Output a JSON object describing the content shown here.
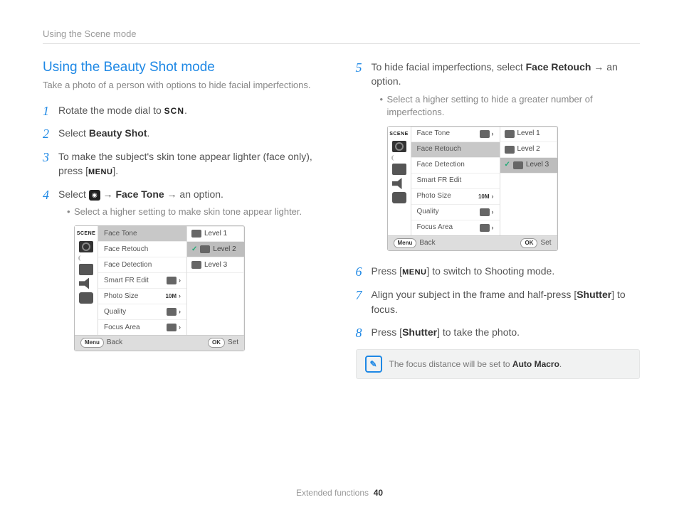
{
  "header": {
    "breadcrumb": "Using the Scene mode"
  },
  "title": "Using the Beauty Shot mode",
  "subtitle": "Take a photo of a person with options to hide facial imperfections.",
  "steps": {
    "s1": {
      "n": "1",
      "pre": "Rotate the mode dial to ",
      "scn": "SCN",
      "post": "."
    },
    "s2": {
      "n": "2",
      "pre": "Select ",
      "bold": "Beauty Shot",
      "post": "."
    },
    "s3": {
      "n": "3",
      "line": "To make the subject's skin tone appear lighter (face only), press [",
      "menu": "MENU",
      "post": "]."
    },
    "s4": {
      "n": "4",
      "pre": "Select ",
      "cam": "📷",
      "arrow1": " → ",
      "bold": "Face Tone",
      "arrow2": " → an option.",
      "sub": "Select a higher setting to make skin tone appear lighter."
    },
    "s5": {
      "n": "5",
      "pre": "To hide facial imperfections, select ",
      "bold": "Face Retouch",
      "post": " → an option.",
      "sub": "Select a higher setting to hide a greater number of imperfections."
    },
    "s6": {
      "n": "6",
      "pre": "Press [",
      "menu": "MENU",
      "post": "] to switch to Shooting mode."
    },
    "s7": {
      "n": "7",
      "pre": "Align your subject in the frame and half-press [",
      "bold": "Shutter",
      "post": "] to focus."
    },
    "s8": {
      "n": "8",
      "pre": "Press [",
      "bold": "Shutter",
      "post": "] to take the photo."
    }
  },
  "lcd": {
    "scene": "SCENE",
    "items": [
      "Face Tone",
      "Face Retouch",
      "Face Detection",
      "Smart FR Edit",
      "Photo Size",
      "Quality",
      "Focus Area"
    ],
    "levels": [
      "Level 1",
      "Level 2",
      "Level 3"
    ],
    "photoSizeVal": "10M",
    "foot": {
      "menu": "Menu",
      "back": "Back",
      "ok": "OK",
      "set": "Set"
    }
  },
  "note": {
    "pre": "The focus distance will be set to ",
    "bold": "Auto Macro",
    "post": "."
  },
  "footer": {
    "section": "Extended functions",
    "page": "40"
  }
}
